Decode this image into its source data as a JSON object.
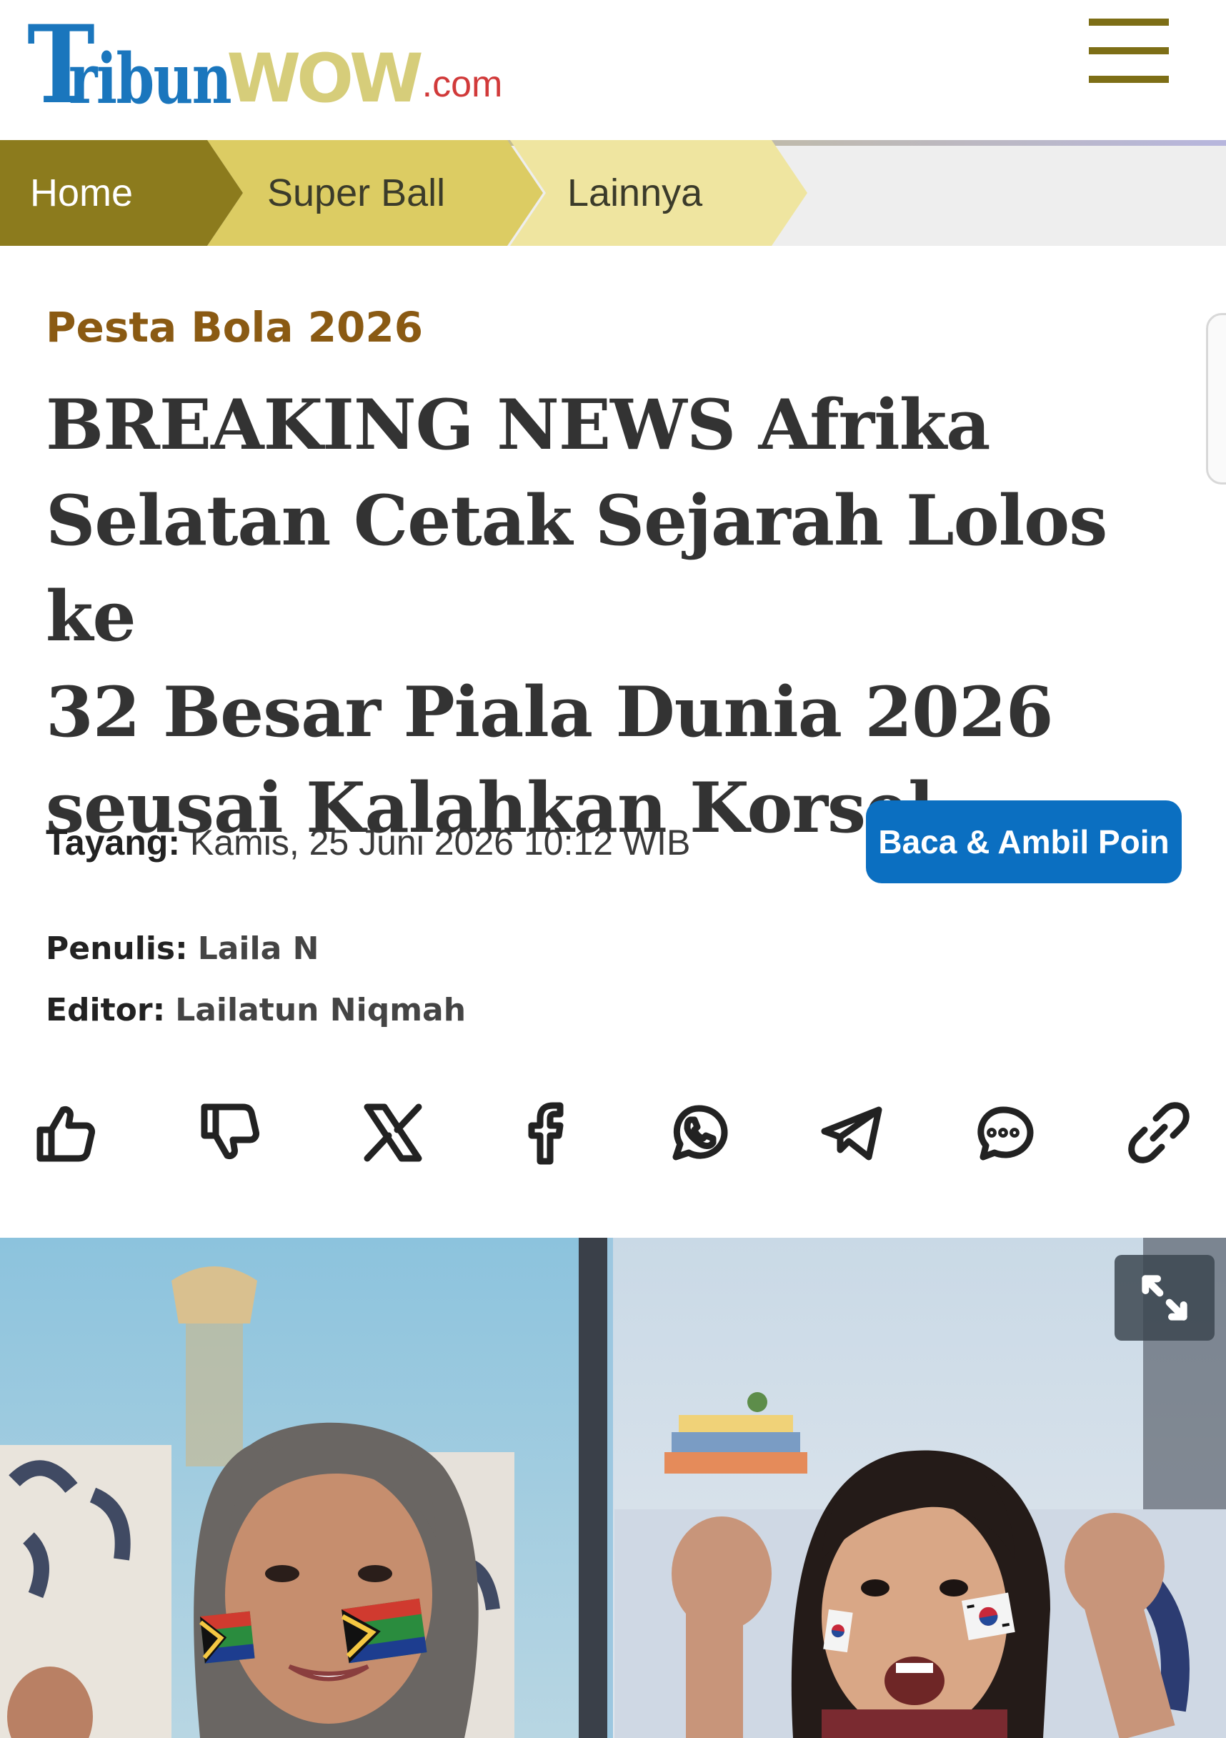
{
  "header": {
    "logo_t": "T",
    "logo_ribun": "ribun",
    "logo_wow": "WOW",
    "logo_com": ".com",
    "menu_icon": "hamburger-menu-icon"
  },
  "breadcrumb": {
    "items": [
      {
        "label": "Home"
      },
      {
        "label": "Super Ball"
      },
      {
        "label": "Lainnya"
      }
    ]
  },
  "article": {
    "category": "Pesta Bola 2026",
    "headline_lines": [
      "BREAKING NEWS Afrika",
      "Selatan Cetak Sejarah Lolos ke",
      "32 Besar Piala Dunia 2026",
      "seusai Kalahkan Korsel"
    ],
    "published_label": "Tayang:",
    "published_value": "Kamis, 25 Juni 2026 10:12 WIB",
    "cta_button": "Baca & Ambil Poin",
    "writer_label": "Penulis:",
    "writer_value": "Laila N",
    "editor_label": "Editor:",
    "editor_value": "Lailatun Niqmah"
  },
  "share": {
    "icons": [
      "thumbs-up-icon",
      "thumbs-down-icon",
      "x-twitter-icon",
      "facebook-icon",
      "whatsapp-icon",
      "telegram-icon",
      "comment-icon",
      "link-icon"
    ]
  },
  "colors": {
    "brand_blue": "#1a76bd",
    "brand_gold": "#8c7b1d",
    "category_brown": "#8a5a13",
    "cta_blue": "#0b6fc1"
  },
  "photo": {
    "expand_icon": "expand-icon"
  }
}
